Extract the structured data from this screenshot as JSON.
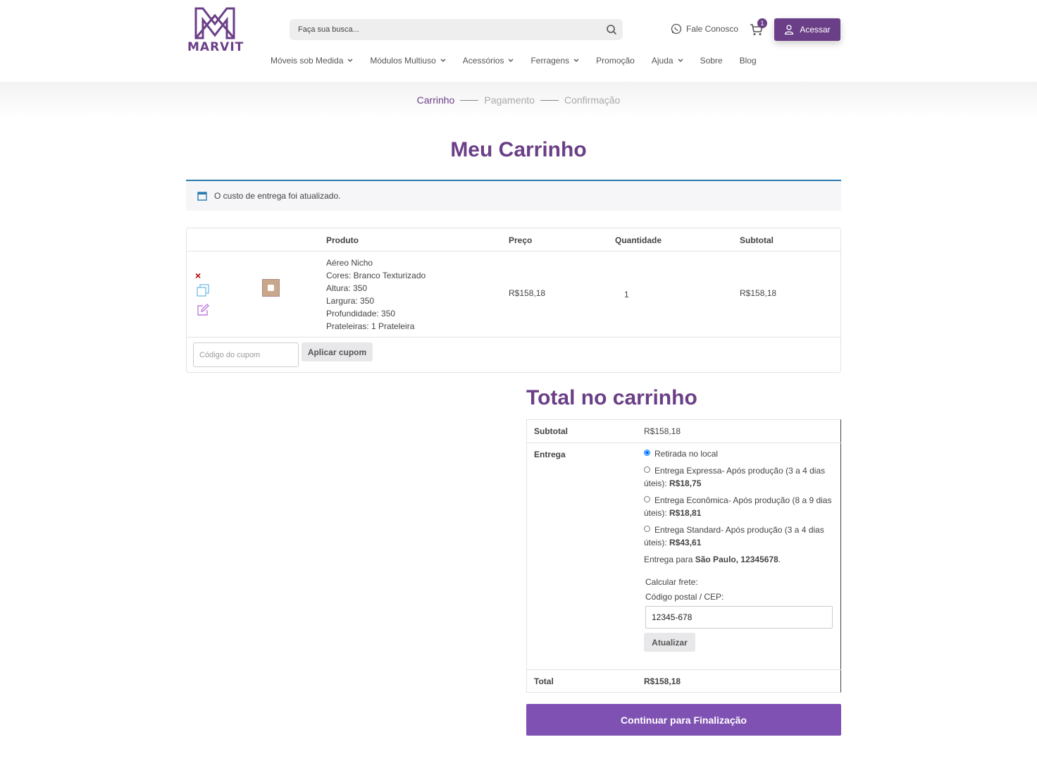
{
  "brand": {
    "name": "MARVIT",
    "color": "#6b3f87"
  },
  "search": {
    "placeholder": "Faça sua busca..."
  },
  "header": {
    "contact_label": "Fale Conosco",
    "cart_count": "1",
    "login_label": "Acessar"
  },
  "nav": {
    "items": [
      {
        "label": "Móveis sob Medida",
        "dropdown": true
      },
      {
        "label": "Módulos Multiuso",
        "dropdown": true
      },
      {
        "label": "Acessórios",
        "dropdown": true
      },
      {
        "label": "Ferragens",
        "dropdown": true
      },
      {
        "label": "Promoção",
        "dropdown": false
      },
      {
        "label": "Ajuda",
        "dropdown": true
      },
      {
        "label": "Sobre",
        "dropdown": false
      },
      {
        "label": "Blog",
        "dropdown": false
      }
    ]
  },
  "steps": {
    "step1": "Carrinho",
    "step2": "Pagamento",
    "step3": "Confirmação"
  },
  "page": {
    "title": "Meu Carrinho"
  },
  "notice": {
    "text": "O custo de entrega foi atualizado."
  },
  "cart": {
    "headers": {
      "product": "Produto",
      "price": "Preço",
      "quantity": "Quantidade",
      "subtotal": "Subtotal"
    },
    "item": {
      "remove": "×",
      "name": "Aéreo Nicho",
      "details": [
        "Cores: Branco Texturizado",
        "Altura: 350",
        "Largura: 350",
        "Profundidade: 350",
        "Prateleiras: 1 Prateleira"
      ],
      "price": "R$158,18",
      "quantity": "1",
      "subtotal": "R$158,18"
    },
    "coupon": {
      "placeholder": "Código do cupom",
      "button": "Aplicar cupom"
    }
  },
  "totals": {
    "title": "Total no carrinho",
    "subtotal_label": "Subtotal",
    "subtotal_value": "R$158,18",
    "shipping_label": "Entrega",
    "options": {
      "pickup": "Retirada no local",
      "express_text": "Entrega Expressa- Após produção (3 a 4 dias úteis): ",
      "express_price": "R$18,75",
      "economica_text": "Entrega Econômica- Após produção (8 a 9 dias úteis): ",
      "economica_price": "R$18,81",
      "standard_text": "Entrega Standard- Após produção (3 a 4 dias úteis): ",
      "standard_price": "R$43,61"
    },
    "ship_to_prefix": "Entrega para ",
    "ship_to_location": "São Paulo, 12345678",
    "ship_to_suffix": ".",
    "calc_label": "Calcular frete:",
    "cep_label": "Código postal / CEP:",
    "cep_value": "12345-678",
    "update_button": "Atualizar",
    "total_label": "Total",
    "total_value": "R$158,18"
  },
  "checkout": {
    "button": "Continuar para Finalização"
  }
}
